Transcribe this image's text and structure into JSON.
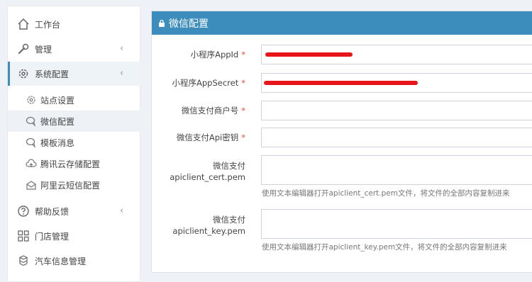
{
  "sidebar": {
    "items": [
      {
        "label": "工作台",
        "icon": "home-icon"
      },
      {
        "label": "管理",
        "icon": "wrench-icon",
        "chevron": "‹"
      },
      {
        "label": "系统配置",
        "icon": "gear-icon",
        "chevron": "‹"
      },
      {
        "label": "帮助反馈",
        "icon": "question-icon",
        "chevron": "‹"
      },
      {
        "label": "门店管理",
        "icon": "grid-icon"
      },
      {
        "label": "汽车信息管理",
        "icon": "cubes-icon"
      }
    ],
    "sub_items": [
      {
        "label": "站点设置",
        "icon": "cog-icon"
      },
      {
        "label": "微信配置",
        "icon": "chat-icon"
      },
      {
        "label": "模板消息",
        "icon": "chat-icon"
      },
      {
        "label": "腾讯云存储配置",
        "icon": "cloud-upload-icon"
      },
      {
        "label": "阿里云短信配置",
        "icon": "envelope-icon"
      }
    ]
  },
  "panel": {
    "title": "微信配置",
    "fields": [
      {
        "label": "小程序AppId",
        "required": "*",
        "value_redacted": true
      },
      {
        "label": "小程序AppSecret",
        "required": "*",
        "value_redacted": true
      },
      {
        "label": "微信支付商户号",
        "required": "*",
        "value": ""
      },
      {
        "label": "微信支付Api密钥",
        "required": "*",
        "value": ""
      },
      {
        "label_line1": "微信支付",
        "label_line2": "apiclient_cert.pem",
        "value": "",
        "help": "使用文本编辑器打开apiclient_cert.pem文件，将文件的全部内容复制进来"
      },
      {
        "label_line1": "微信支付",
        "label_line2": "apiclient_key.pem",
        "value": "",
        "help": "使用文本编辑器打开apiclient_key.pem文件，将文件的全部内容复制进来"
      }
    ]
  },
  "colors": {
    "accent": "#3c8dbc",
    "required": "#dd4b39",
    "redaction": "#e8161b"
  }
}
